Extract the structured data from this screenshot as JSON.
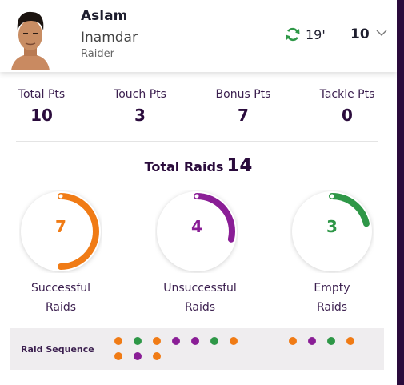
{
  "player": {
    "first_name": "Aslam",
    "last_name": "Inamdar",
    "role": "Raider",
    "time": "19'",
    "points": "10"
  },
  "stats": [
    {
      "label": "Total Pts",
      "value": "10"
    },
    {
      "label": "Touch Pts",
      "value": "3"
    },
    {
      "label": "Bonus Pts",
      "value": "7"
    },
    {
      "label": "Tackle Pts",
      "value": "0"
    }
  ],
  "total_raids": {
    "label": "Total Raids",
    "value": "14"
  },
  "raids": [
    {
      "value": "7",
      "label_line1": "Successful",
      "label_line2": "Raids",
      "color": "#f07b15",
      "fraction": 0.5
    },
    {
      "value": "4",
      "label_line1": "Unsuccessful",
      "label_line2": "Raids",
      "color": "#8a1e96",
      "fraction": 0.2857
    },
    {
      "value": "3",
      "label_line1": "Empty",
      "label_line2": "Raids",
      "color": "#2e9747",
      "fraction": 0.2143
    }
  ],
  "raid_sequence": {
    "label": "Raid Sequence",
    "dots": [
      "orange",
      "green",
      "orange",
      "purple",
      "purple",
      "green",
      "orange",
      "orange",
      "purple",
      "green",
      "orange",
      "orange",
      "purple",
      "orange"
    ]
  },
  "colors": {
    "orange": "#f07b15",
    "green": "#2e9747",
    "purple": "#8a1e96",
    "dark": "#2a0b3c"
  },
  "icons": {
    "refresh": "refresh-icon",
    "chevron": "chevron-down-icon"
  }
}
